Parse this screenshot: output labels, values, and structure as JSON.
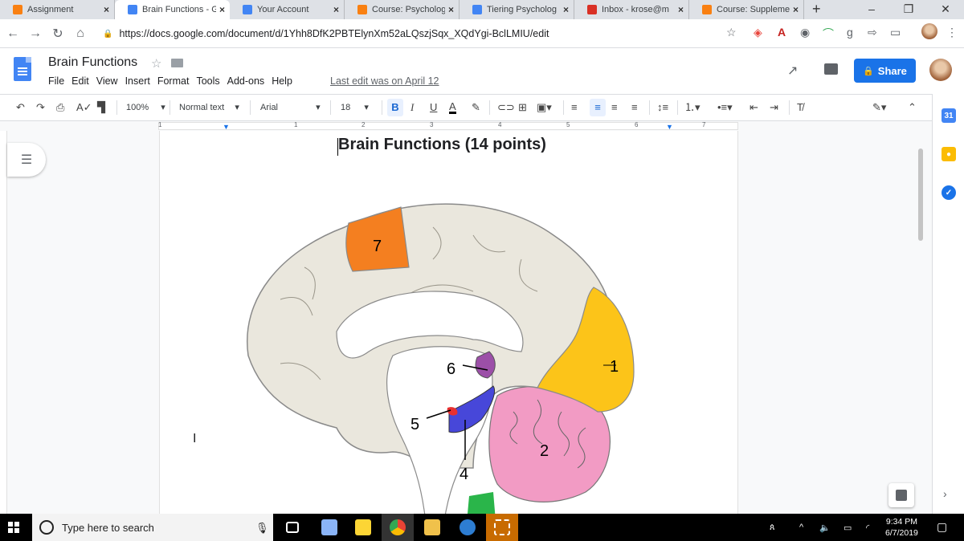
{
  "browser": {
    "tabs": [
      {
        "title": "Assignment",
        "icon": "moodle-icon",
        "color": "#f98012"
      },
      {
        "title": "Brain Functions - G",
        "icon": "docs-icon",
        "color": "#4285f4",
        "active": true
      },
      {
        "title": "Your Account",
        "icon": "account-icon",
        "color": "#4285f4"
      },
      {
        "title": "Course: Psycholog",
        "icon": "moodle-icon",
        "color": "#f98012"
      },
      {
        "title": "Tiering Psycholog",
        "icon": "docs-icon",
        "color": "#4285f4"
      },
      {
        "title": "Inbox - krose@m",
        "icon": "gmail-icon",
        "color": "#d93025"
      },
      {
        "title": "Course: Suppleme",
        "icon": "moodle-icon",
        "color": "#f98012"
      }
    ],
    "new_tab": "+",
    "url": "https://docs.google.com/document/d/1Yhh8DfK2PBTElynXm52aLQszjSqx_XQdYgi-BclLMIU/edit"
  },
  "doc": {
    "title": "Brain Functions",
    "menus": [
      "File",
      "Edit",
      "View",
      "Insert",
      "Format",
      "Tools",
      "Add-ons",
      "Help"
    ],
    "last_edit": "Last edit was on April 12",
    "share_label": "Share",
    "heading": "Brain Functions (14 points)"
  },
  "toolbar": {
    "zoom": "100%",
    "style": "Normal text",
    "font": "Arial",
    "size": "18",
    "bold": "B",
    "italic": "I",
    "underline": "U",
    "textcolor": "A"
  },
  "ruler": {
    "marks": [
      "1",
      "1",
      "2",
      "3",
      "4",
      "5",
      "6",
      "7"
    ]
  },
  "diagram": {
    "labels": [
      "7",
      "1",
      "6",
      "5",
      "4",
      "2"
    ],
    "colors": {
      "parietal": "#f47f20",
      "occipital": "#fcc419",
      "cerebellum": "#f29bc4",
      "hippocampus": "#4747d9",
      "amygdala": "#e83030",
      "thalamus": "#9c4fa8",
      "brainstem": "#2ab54a",
      "cortex": "#eae7dd"
    }
  },
  "taskbar": {
    "search_placeholder": "Type here to search",
    "time": "9:34 PM",
    "date": "6/7/2019"
  }
}
